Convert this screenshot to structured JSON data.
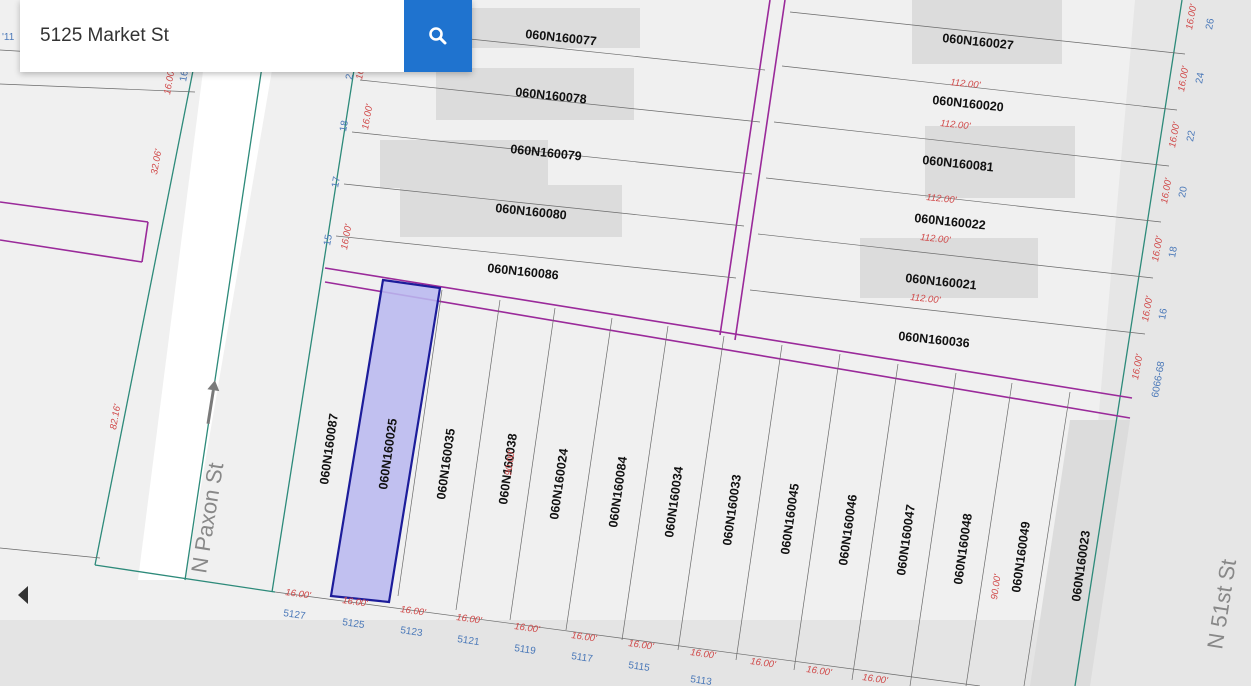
{
  "search": {
    "value": "5125 Market St"
  },
  "icons": {
    "search": "search-icon",
    "collapse": "caret-left-icon",
    "arrow": "one-way-arrow-icon"
  },
  "colors": {
    "lot_line": "#9a2a9a",
    "row_line": "#2d8a7a",
    "selected_fill": "#b9b8ef",
    "selected_stroke": "#1c1c9a",
    "search_button": "#1f73cf"
  },
  "streets": {
    "paxon": "N Paxon St",
    "fifty_first": "N 51st St"
  },
  "parcels_upper_left": [
    "060N160077",
    "060N160078",
    "060N160079",
    "060N160080",
    "060N160086"
  ],
  "parcels_upper_right": [
    "060N160027",
    "060N160020",
    "060N160081",
    "060N160022",
    "060N160021",
    "060N160036"
  ],
  "parcels_lower": [
    "060N160087",
    "060N160025",
    "060N160035",
    "060N160038",
    "060N160024",
    "060N160084",
    "060N160034",
    "060N160033",
    "060N160045",
    "060N160046",
    "060N160047",
    "060N160048",
    "060N160049",
    "060N160023"
  ],
  "selected_parcel": "060N160025",
  "addresses_lower": [
    "5127",
    "5125",
    "5123",
    "5121",
    "5119",
    "5117",
    "5115",
    "5113"
  ],
  "frontage_dims": [
    "16.00'",
    "16.00'",
    "16.00'",
    "16.00'",
    "16.00'",
    "16.00'",
    "16.00'",
    "16.00'",
    "16.00'",
    "16.00'",
    "16.00'"
  ],
  "depth_dims": [
    "90.00'",
    "90.00'"
  ],
  "right_col_dims": [
    "112.00'",
    "112.00'",
    "112.00'",
    "112.00'",
    "112.00'"
  ],
  "right_edge_dims": [
    "16.00'",
    "16.00'",
    "16.00'",
    "16.00'",
    "16.00'",
    "16.00'",
    "16.00'"
  ],
  "right_edge_addrs": [
    "26",
    "24",
    "22",
    "20",
    "18",
    "16",
    "6066-68"
  ],
  "upper_left_edge_dims": [
    "16.00'",
    "16.00'",
    "16.00'"
  ],
  "upper_left_edge_addrs": [
    "18",
    "17",
    "15"
  ],
  "far_left_dims": [
    "16.00'",
    "32.06'",
    "82.16'"
  ],
  "far_left_addrs": [
    "16"
  ],
  "misc": {
    "partial_left": "'11",
    "partial_top": "2"
  }
}
